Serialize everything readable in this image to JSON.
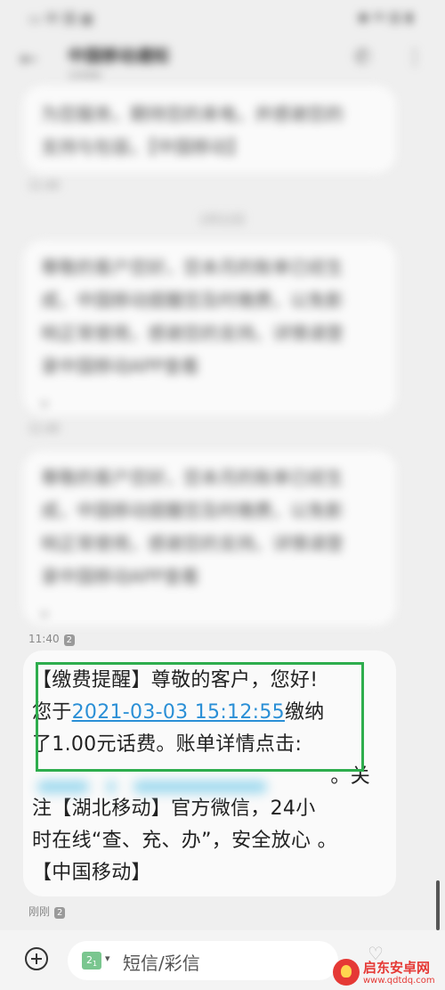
{
  "statusbar": {
    "left": "▭ 中 国 ▦",
    "right": "◉ ✉ ▥ ▮"
  },
  "header": {
    "title": "中国移动通知",
    "subtitle": "10086",
    "back_icon": "arrow-left-icon",
    "call_icon": "phone-icon",
    "more_icon": "more-vertical-icon"
  },
  "messages_hidden": {
    "msg1_lines": [
      "为您服务，期待您的来电，并感谢您的",
      "支持与包容。【中国移动】"
    ],
    "time1": "11:40",
    "date_separator": "2月12日",
    "msg2_lines": [
      "尊敬的客户您好，您本月的账单已经生",
      "成，中国移动提醒您及时缴费，以免影",
      "响正常使用，感谢您的支持。详情请登",
      "录中国移动APP查看",
      "。"
    ],
    "time2": "11:40",
    "msg3_lines": [
      "尊敬的客户您好，您本月的账单已经生",
      "成，中国移动提醒您及时缴费，以免影",
      "响正常使用，感谢您的支持。详情请登",
      "录中国移动APP查看",
      "。"
    ]
  },
  "time3": "11:40",
  "sim_badge": "2",
  "latest_message": {
    "line1": "【缴费提醒】尊敬的客户，您好!",
    "line2_prefix": "您于",
    "line2_datetime": "2021-03-03 15:12:55",
    "line2_suffix": "缴纳",
    "line3": "了1.00元话费。账单详情点击:",
    "line4_suffix": "。关",
    "line5": "注【湖北移动】官方微信，24小",
    "line6": "时在线“查、充、办”，安全放心 。",
    "line7": "【中国移动】",
    "time": "刚刚",
    "sim": "2"
  },
  "input": {
    "sim_label": "2",
    "sim_sub": "1",
    "placeholder": "短信/彩信"
  },
  "watermark": {
    "name": "启东安卓网",
    "url": "www.qdtdq.com"
  },
  "colors": {
    "link": "#2a8fd6",
    "highlight_box": "#2ead4d",
    "background": "#efefef"
  }
}
